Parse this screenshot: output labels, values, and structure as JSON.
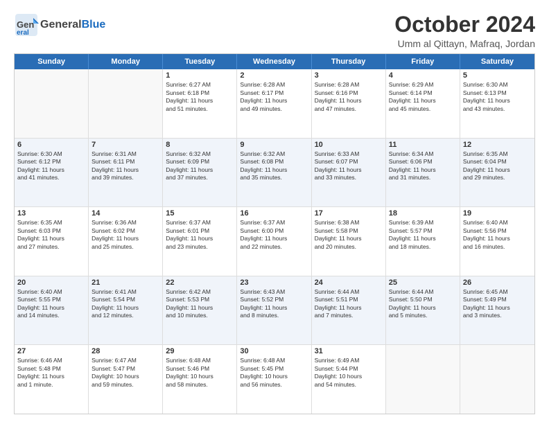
{
  "header": {
    "logo_general": "General",
    "logo_blue": "Blue",
    "month_title": "October 2024",
    "location": "Umm al Qittayn, Mafraq, Jordan"
  },
  "days_of_week": [
    "Sunday",
    "Monday",
    "Tuesday",
    "Wednesday",
    "Thursday",
    "Friday",
    "Saturday"
  ],
  "weeks": [
    [
      {
        "day": "",
        "lines": [],
        "empty": true
      },
      {
        "day": "",
        "lines": [],
        "empty": true
      },
      {
        "day": "1",
        "lines": [
          "Sunrise: 6:27 AM",
          "Sunset: 6:18 PM",
          "Daylight: 11 hours",
          "and 51 minutes."
        ]
      },
      {
        "day": "2",
        "lines": [
          "Sunrise: 6:28 AM",
          "Sunset: 6:17 PM",
          "Daylight: 11 hours",
          "and 49 minutes."
        ]
      },
      {
        "day": "3",
        "lines": [
          "Sunrise: 6:28 AM",
          "Sunset: 6:16 PM",
          "Daylight: 11 hours",
          "and 47 minutes."
        ]
      },
      {
        "day": "4",
        "lines": [
          "Sunrise: 6:29 AM",
          "Sunset: 6:14 PM",
          "Daylight: 11 hours",
          "and 45 minutes."
        ]
      },
      {
        "day": "5",
        "lines": [
          "Sunrise: 6:30 AM",
          "Sunset: 6:13 PM",
          "Daylight: 11 hours",
          "and 43 minutes."
        ]
      }
    ],
    [
      {
        "day": "6",
        "lines": [
          "Sunrise: 6:30 AM",
          "Sunset: 6:12 PM",
          "Daylight: 11 hours",
          "and 41 minutes."
        ]
      },
      {
        "day": "7",
        "lines": [
          "Sunrise: 6:31 AM",
          "Sunset: 6:11 PM",
          "Daylight: 11 hours",
          "and 39 minutes."
        ]
      },
      {
        "day": "8",
        "lines": [
          "Sunrise: 6:32 AM",
          "Sunset: 6:09 PM",
          "Daylight: 11 hours",
          "and 37 minutes."
        ]
      },
      {
        "day": "9",
        "lines": [
          "Sunrise: 6:32 AM",
          "Sunset: 6:08 PM",
          "Daylight: 11 hours",
          "and 35 minutes."
        ]
      },
      {
        "day": "10",
        "lines": [
          "Sunrise: 6:33 AM",
          "Sunset: 6:07 PM",
          "Daylight: 11 hours",
          "and 33 minutes."
        ]
      },
      {
        "day": "11",
        "lines": [
          "Sunrise: 6:34 AM",
          "Sunset: 6:06 PM",
          "Daylight: 11 hours",
          "and 31 minutes."
        ]
      },
      {
        "day": "12",
        "lines": [
          "Sunrise: 6:35 AM",
          "Sunset: 6:04 PM",
          "Daylight: 11 hours",
          "and 29 minutes."
        ]
      }
    ],
    [
      {
        "day": "13",
        "lines": [
          "Sunrise: 6:35 AM",
          "Sunset: 6:03 PM",
          "Daylight: 11 hours",
          "and 27 minutes."
        ]
      },
      {
        "day": "14",
        "lines": [
          "Sunrise: 6:36 AM",
          "Sunset: 6:02 PM",
          "Daylight: 11 hours",
          "and 25 minutes."
        ]
      },
      {
        "day": "15",
        "lines": [
          "Sunrise: 6:37 AM",
          "Sunset: 6:01 PM",
          "Daylight: 11 hours",
          "and 23 minutes."
        ]
      },
      {
        "day": "16",
        "lines": [
          "Sunrise: 6:37 AM",
          "Sunset: 6:00 PM",
          "Daylight: 11 hours",
          "and 22 minutes."
        ]
      },
      {
        "day": "17",
        "lines": [
          "Sunrise: 6:38 AM",
          "Sunset: 5:58 PM",
          "Daylight: 11 hours",
          "and 20 minutes."
        ]
      },
      {
        "day": "18",
        "lines": [
          "Sunrise: 6:39 AM",
          "Sunset: 5:57 PM",
          "Daylight: 11 hours",
          "and 18 minutes."
        ]
      },
      {
        "day": "19",
        "lines": [
          "Sunrise: 6:40 AM",
          "Sunset: 5:56 PM",
          "Daylight: 11 hours",
          "and 16 minutes."
        ]
      }
    ],
    [
      {
        "day": "20",
        "lines": [
          "Sunrise: 6:40 AM",
          "Sunset: 5:55 PM",
          "Daylight: 11 hours",
          "and 14 minutes."
        ]
      },
      {
        "day": "21",
        "lines": [
          "Sunrise: 6:41 AM",
          "Sunset: 5:54 PM",
          "Daylight: 11 hours",
          "and 12 minutes."
        ]
      },
      {
        "day": "22",
        "lines": [
          "Sunrise: 6:42 AM",
          "Sunset: 5:53 PM",
          "Daylight: 11 hours",
          "and 10 minutes."
        ]
      },
      {
        "day": "23",
        "lines": [
          "Sunrise: 6:43 AM",
          "Sunset: 5:52 PM",
          "Daylight: 11 hours",
          "and 8 minutes."
        ]
      },
      {
        "day": "24",
        "lines": [
          "Sunrise: 6:44 AM",
          "Sunset: 5:51 PM",
          "Daylight: 11 hours",
          "and 7 minutes."
        ]
      },
      {
        "day": "25",
        "lines": [
          "Sunrise: 6:44 AM",
          "Sunset: 5:50 PM",
          "Daylight: 11 hours",
          "and 5 minutes."
        ]
      },
      {
        "day": "26",
        "lines": [
          "Sunrise: 6:45 AM",
          "Sunset: 5:49 PM",
          "Daylight: 11 hours",
          "and 3 minutes."
        ]
      }
    ],
    [
      {
        "day": "27",
        "lines": [
          "Sunrise: 6:46 AM",
          "Sunset: 5:48 PM",
          "Daylight: 11 hours",
          "and 1 minute."
        ]
      },
      {
        "day": "28",
        "lines": [
          "Sunrise: 6:47 AM",
          "Sunset: 5:47 PM",
          "Daylight: 10 hours",
          "and 59 minutes."
        ]
      },
      {
        "day": "29",
        "lines": [
          "Sunrise: 6:48 AM",
          "Sunset: 5:46 PM",
          "Daylight: 10 hours",
          "and 58 minutes."
        ]
      },
      {
        "day": "30",
        "lines": [
          "Sunrise: 6:48 AM",
          "Sunset: 5:45 PM",
          "Daylight: 10 hours",
          "and 56 minutes."
        ]
      },
      {
        "day": "31",
        "lines": [
          "Sunrise: 6:49 AM",
          "Sunset: 5:44 PM",
          "Daylight: 10 hours",
          "and 54 minutes."
        ]
      },
      {
        "day": "",
        "lines": [],
        "empty": true
      },
      {
        "day": "",
        "lines": [],
        "empty": true
      }
    ]
  ]
}
